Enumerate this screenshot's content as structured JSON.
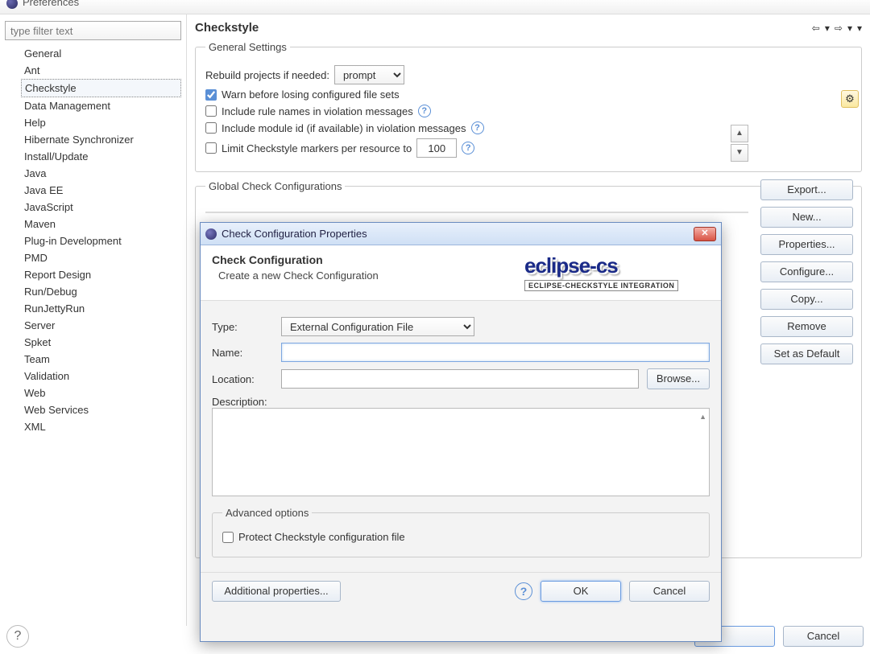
{
  "window": {
    "title": "Preferences"
  },
  "sidebar": {
    "filter_placeholder": "type filter text",
    "items": [
      "General",
      "Ant",
      "Checkstyle",
      "Data Management",
      "Help",
      "Hibernate Synchronizer",
      "Install/Update",
      "Java",
      "Java EE",
      "JavaScript",
      "Maven",
      "Plug-in Development",
      "PMD",
      "Report Design",
      "Run/Debug",
      "RunJettyRun",
      "Server",
      "Spket",
      "Team",
      "Validation",
      "Web",
      "Web Services",
      "XML"
    ],
    "selected_index": 2
  },
  "page": {
    "title": "Checkstyle",
    "general": {
      "legend": "General Settings",
      "rebuild_label": "Rebuild projects if needed:",
      "rebuild_value": "prompt",
      "warn_checked": true,
      "warn_label": "Warn before losing configured file sets",
      "rule_names_checked": false,
      "rule_names_label": "Include rule names in violation messages",
      "module_id_checked": false,
      "module_id_label": "Include module id (if available) in violation messages",
      "limit_checked": false,
      "limit_label": "Limit Checkstyle markers per resource to",
      "limit_value": "100"
    },
    "global": {
      "legend": "Global Check Configurations",
      "buttons": {
        "new": "New...",
        "properties": "Properties...",
        "configure": "Configure...",
        "copy": "Copy...",
        "remove": "Remove",
        "set_default": "Set as Default",
        "export": "Export..."
      }
    }
  },
  "footer": {
    "cancel": "Cancel"
  },
  "dialog": {
    "title": "Check Configuration Properties",
    "heading": "Check Configuration",
    "subheading": "Create a new Check Configuration",
    "logo_main": "eclipse-cs",
    "logo_sub": "ECLIPSE-CHECKSTYLE INTEGRATION",
    "type_label": "Type:",
    "type_value": "External Configuration File",
    "name_label": "Name:",
    "name_value": "",
    "location_label": "Location:",
    "location_value": "",
    "browse": "Browse...",
    "description_label": "Description:",
    "advanced_legend": "Advanced options",
    "protect_checked": false,
    "protect_label": "Protect Checkstyle configuration file",
    "additional": "Additional properties...",
    "ok": "OK",
    "cancel": "Cancel"
  }
}
